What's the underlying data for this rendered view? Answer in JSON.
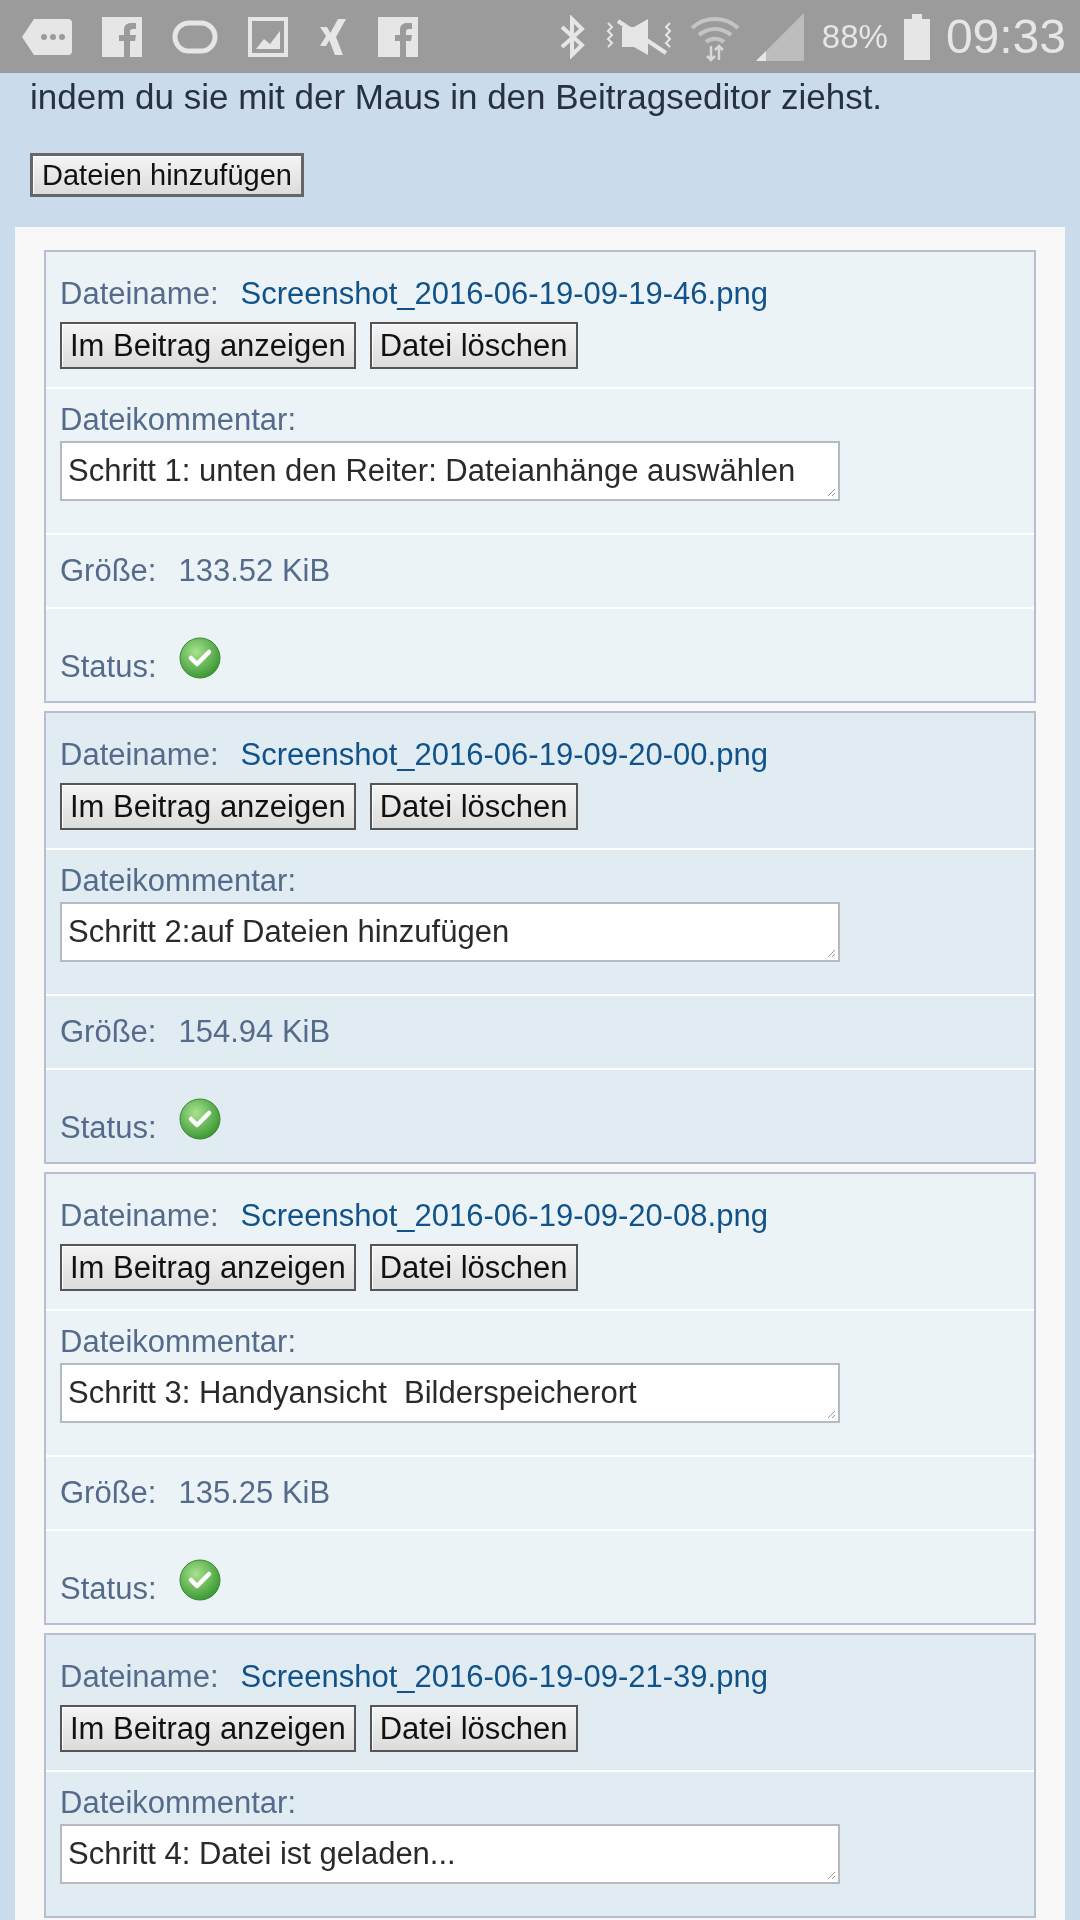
{
  "status_bar": {
    "battery": "88%",
    "time": "09:33"
  },
  "intro_text": "indem du sie mit der Maus in den Beitragseditor ziehst.",
  "add_button": "Dateien hinzufügen",
  "files": [
    {
      "filename_label": "Dateiname:",
      "filename": "Screenshot_2016-06-19-09-19-46.png",
      "buttons": [
        "Im Beitrag anzeigen",
        "Datei löschen"
      ],
      "comment_label": "Dateikommentar:",
      "comment": "Schritt 1: unten den Reiter: Dateianhänge auswählen",
      "size_label": "Größe:",
      "size": "133.52 KiB",
      "status_label": "Status:",
      "uploaded": true
    },
    {
      "filename_label": "Dateiname:",
      "filename": "Screenshot_2016-06-19-09-20-00.png",
      "buttons": [
        "Im Beitrag anzeigen",
        "Datei löschen"
      ],
      "comment_label": "Dateikommentar:",
      "comment": "Schritt 2:auf Dateien hinzufügen",
      "size_label": "Größe:",
      "size": "154.94 KiB",
      "status_label": "Status:",
      "uploaded": true
    },
    {
      "filename_label": "Dateiname:",
      "filename": "Screenshot_2016-06-19-09-20-08.png",
      "buttons": [
        "Im Beitrag anzeigen",
        "Datei löschen"
      ],
      "comment_label": "Dateikommentar:",
      "comment": "Schritt 3: Handyansicht  Bilderspeicherort",
      "size_label": "Größe:",
      "size": "135.25 KiB",
      "status_label": "Status:",
      "uploaded": true
    },
    {
      "filename_label": "Dateiname:",
      "filename": "Screenshot_2016-06-19-09-21-39.png",
      "buttons": [
        "Im Beitrag anzeigen",
        "Datei löschen"
      ],
      "comment_label": "Dateikommentar:",
      "comment": "Schritt 4: Datei ist geladen..."
    }
  ]
}
